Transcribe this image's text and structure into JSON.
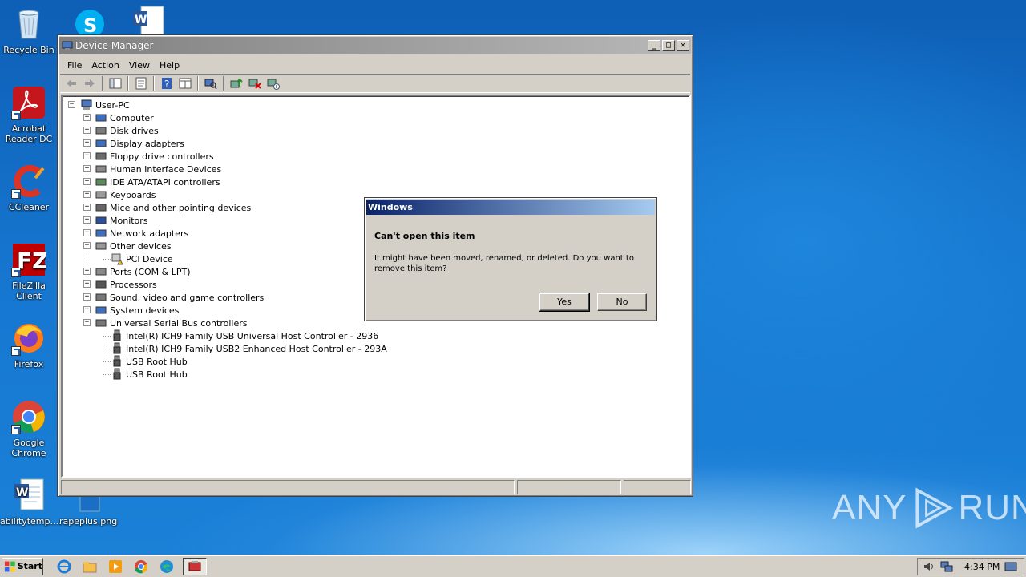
{
  "desktop": {
    "icons": [
      {
        "label": "Recycle Bin",
        "icon": "recycle-bin-icon"
      },
      {
        "label": "Acrobat Reader DC",
        "icon": "acrobat-icon"
      },
      {
        "label": "CCleaner",
        "icon": "ccleaner-icon"
      },
      {
        "label": "FileZilla Client",
        "icon": "filezilla-icon"
      },
      {
        "label": "Firefox",
        "icon": "firefox-icon"
      },
      {
        "label": "Google Chrome",
        "icon": "chrome-icon"
      },
      {
        "label": "abilitytemp....",
        "icon": "word-doc-icon"
      },
      {
        "label": "rapeplus.png",
        "icon": "image-file-icon"
      }
    ]
  },
  "window": {
    "title": "Device Manager",
    "menu": [
      "File",
      "Action",
      "View",
      "Help"
    ],
    "tree": {
      "root": "User-PC",
      "items": [
        {
          "label": "Computer",
          "expanded": false
        },
        {
          "label": "Disk drives",
          "expanded": false
        },
        {
          "label": "Display adapters",
          "expanded": false
        },
        {
          "label": "Floppy drive controllers",
          "expanded": false
        },
        {
          "label": "Human Interface Devices",
          "expanded": false
        },
        {
          "label": "IDE ATA/ATAPI controllers",
          "expanded": false
        },
        {
          "label": "Keyboards",
          "expanded": false
        },
        {
          "label": "Mice and other pointing devices",
          "expanded": false
        },
        {
          "label": "Monitors",
          "expanded": false
        },
        {
          "label": "Network adapters",
          "expanded": false
        },
        {
          "label": "Other devices",
          "expanded": true,
          "children": [
            "PCI Device"
          ]
        },
        {
          "label": "Ports (COM & LPT)",
          "expanded": false
        },
        {
          "label": "Processors",
          "expanded": false
        },
        {
          "label": "Sound, video and game controllers",
          "expanded": false
        },
        {
          "label": "System devices",
          "expanded": false
        },
        {
          "label": "Universal Serial Bus controllers",
          "expanded": true,
          "children": [
            "Intel(R) ICH9 Family USB Universal Host Controller - 2936",
            "Intel(R) ICH9 Family USB2 Enhanced Host Controller - 293A",
            "USB Root Hub",
            "USB Root Hub"
          ]
        }
      ]
    }
  },
  "dialog": {
    "title": "Windows",
    "heading": "Can't open this item",
    "message": "It might have been moved, renamed, or deleted. Do you want to remove this item?",
    "yes_label": "Yes",
    "no_label": "No"
  },
  "taskbar": {
    "start_label": "Start",
    "clock": "4:34 PM",
    "apps": [
      "ie-icon",
      "explorer-icon",
      "media-player-icon",
      "chrome-icon",
      "edge-icon",
      "device-manager-icon"
    ]
  },
  "watermark": {
    "text_left": "ANY",
    "text_right": "RUN"
  }
}
